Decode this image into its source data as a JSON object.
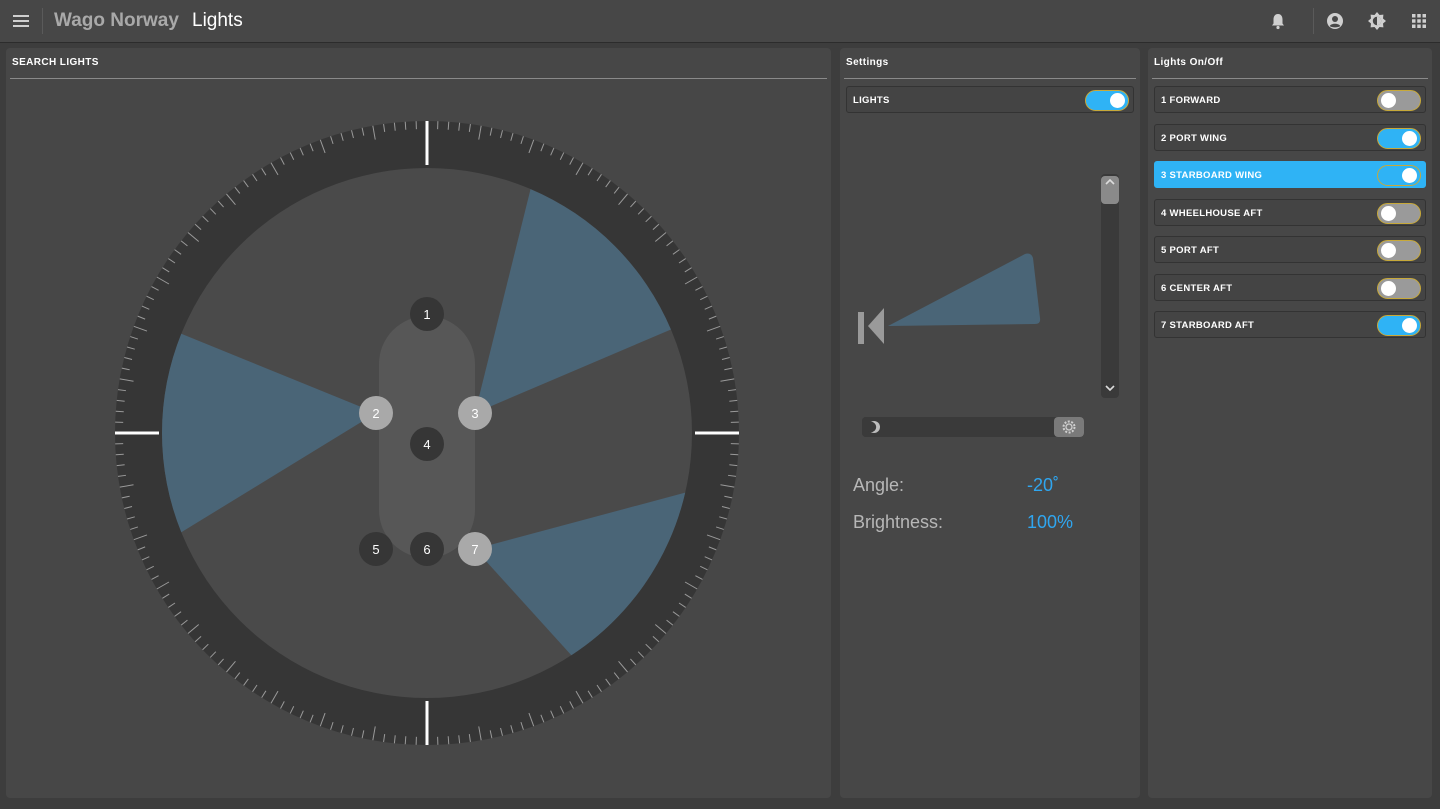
{
  "header": {
    "brand": "Wago Norway",
    "title": "Lights",
    "icons": [
      "menu-icon",
      "bell-icon",
      "account-icon",
      "brightness-icon",
      "apps-grid-icon"
    ]
  },
  "search_panel": {
    "title": "SEARCH LIGHTS",
    "lights": [
      {
        "id": "1",
        "active": false
      },
      {
        "id": "2",
        "active": true,
        "beam_deg": 270
      },
      {
        "id": "3",
        "active": true,
        "beam_deg": 45
      },
      {
        "id": "4",
        "active": false
      },
      {
        "id": "5",
        "active": false
      },
      {
        "id": "6",
        "active": false
      },
      {
        "id": "7",
        "active": true,
        "beam_deg": 125
      }
    ]
  },
  "settings": {
    "title": "Settings",
    "lights_label": "LIGHTS",
    "lights_on": true,
    "angle_label": "Angle:",
    "angle_value": "-20˚",
    "brightness_label": "Brightness:",
    "brightness_value": "100%",
    "brightness_percent": 100
  },
  "onoff": {
    "title": "Lights On/Off",
    "items": [
      {
        "label": "1 FORWARD",
        "on": false,
        "selected": false
      },
      {
        "label": "2 PORT WING",
        "on": true,
        "selected": false
      },
      {
        "label": "3 STARBOARD WING",
        "on": true,
        "selected": true
      },
      {
        "label": "4 WHEELHOUSE AFT",
        "on": false,
        "selected": false
      },
      {
        "label": "5 PORT AFT",
        "on": false,
        "selected": false
      },
      {
        "label": "6 CENTER AFT",
        "on": false,
        "selected": false
      },
      {
        "label": "7 STARBOARD AFT",
        "on": true,
        "selected": false
      }
    ]
  },
  "colors": {
    "accent": "#2fb3f5",
    "beam": "#4a6577",
    "panel": "#474747",
    "background": "#3d3d3d"
  }
}
